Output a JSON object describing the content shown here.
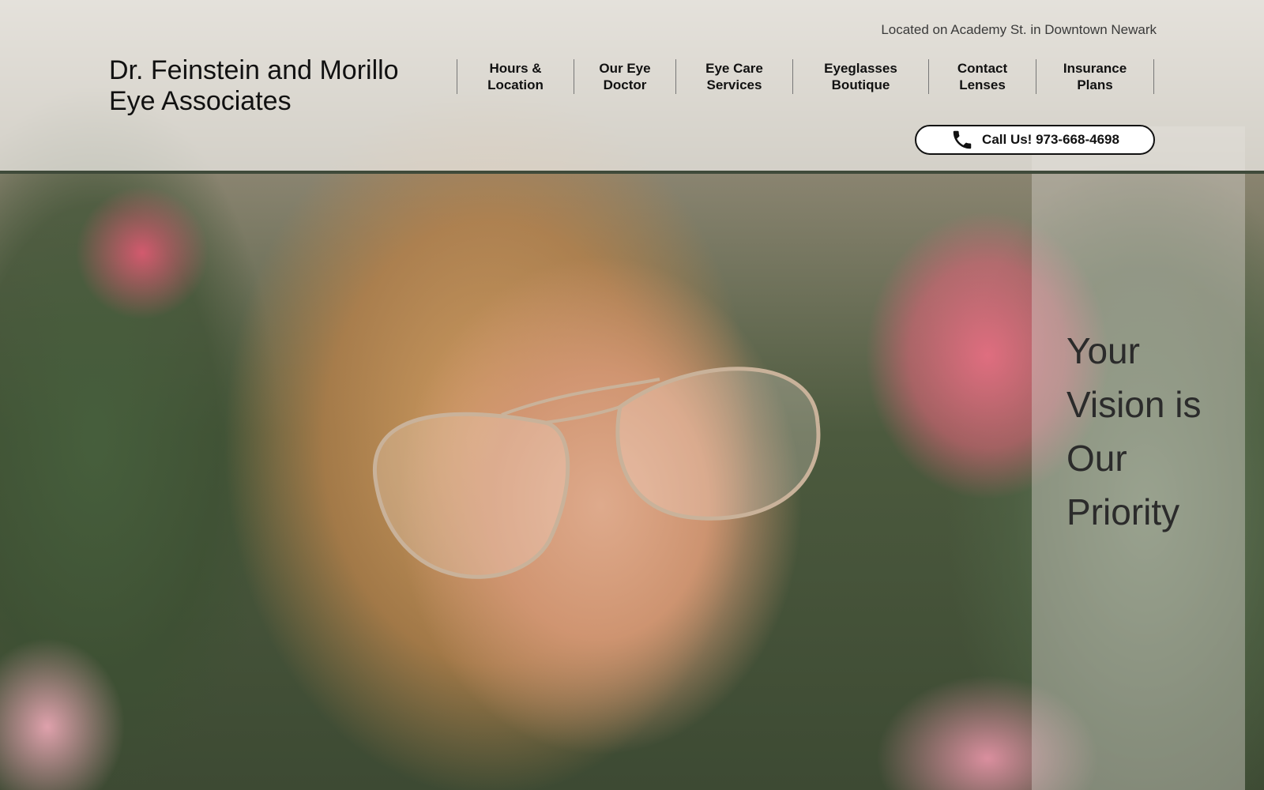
{
  "header": {
    "location_line": "Located on Academy St. in Downtown Newark",
    "brand_line_1": "Dr. Feinstein and Morillo",
    "brand_line_2": "Eye Associates"
  },
  "nav": {
    "items": [
      {
        "line1": "Hours &",
        "line2": "Location"
      },
      {
        "line1": "Our Eye",
        "line2": "Doctor"
      },
      {
        "line1": "Eye Care",
        "line2": "Services"
      },
      {
        "line1": "Eyeglasses",
        "line2": "Boutique"
      },
      {
        "line1": "Contact",
        "line2": "Lenses"
      },
      {
        "line1": "Insurance",
        "line2": "Plans"
      }
    ]
  },
  "call_button": {
    "label": "Call Us! 973-668-4698",
    "icon": "phone-icon"
  },
  "hero": {
    "tagline_words": [
      "Your",
      "Vision is",
      "Our",
      "Priority"
    ]
  },
  "colors": {
    "header_overlay": "#e8e6e0",
    "header_border": "#3f4a3a",
    "text_dark": "#111111",
    "tagline_text": "#2b2b2b"
  }
}
